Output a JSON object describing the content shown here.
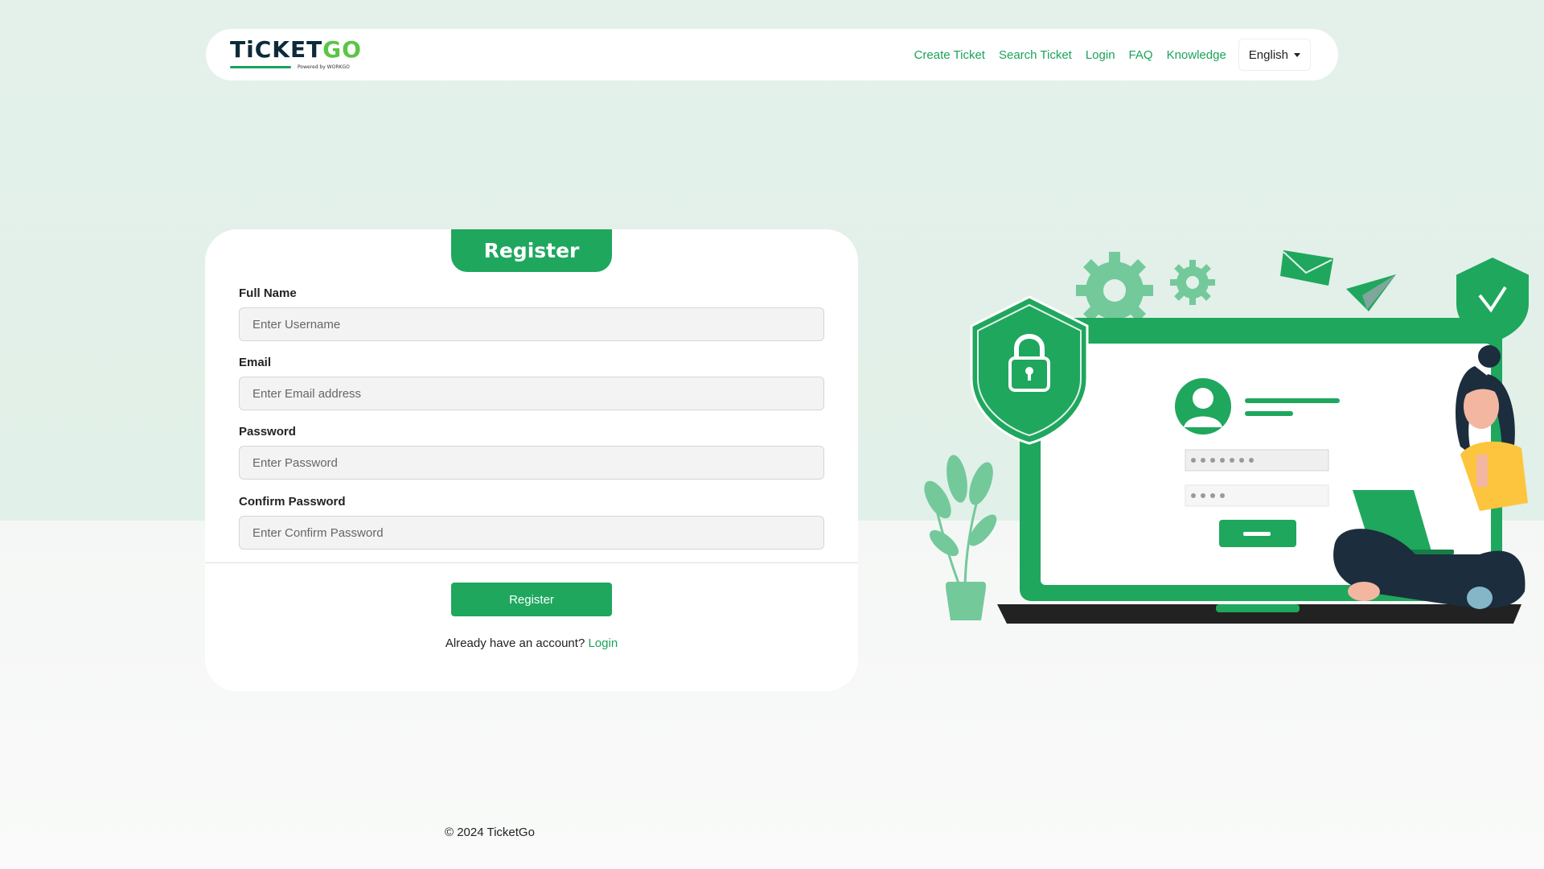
{
  "brand": {
    "logo_text_main": "TiCKET",
    "logo_text_accent": "GO",
    "logo_subtext": "Powered by WORKGO"
  },
  "nav": {
    "links": [
      "Create Ticket",
      "Search Ticket",
      "Login",
      "FAQ",
      "Knowledge"
    ],
    "language": "English"
  },
  "form": {
    "title": "Register",
    "fields": [
      {
        "label": "Full Name",
        "placeholder": "Enter Username"
      },
      {
        "label": "Email",
        "placeholder": "Enter Email address"
      },
      {
        "label": "Password",
        "placeholder": "Enter Password"
      },
      {
        "label": "Confirm Password",
        "placeholder": "Enter Confirm Password"
      }
    ],
    "submit_label": "Register",
    "account_prompt": "Already have an account?",
    "login_link": "Login"
  },
  "footer": {
    "copyright": "© 2024 TicketGo"
  },
  "colors": {
    "primary": "#1fa75e",
    "accent_light": "#5bc545",
    "bg_top": "#e3f1ea",
    "dark": "#0e2a3a",
    "yellow": "#fcc53d"
  }
}
